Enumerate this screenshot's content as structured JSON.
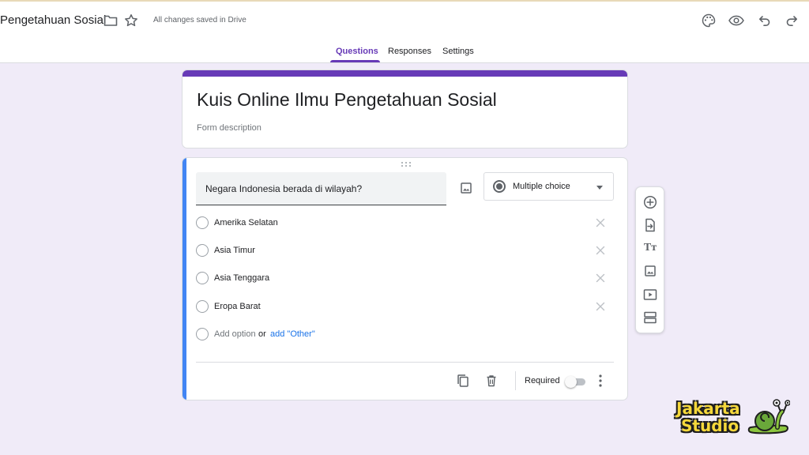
{
  "header": {
    "doc_title": "Pengetahuan Sosial",
    "save_status": "All changes saved in Drive",
    "icons": [
      "folder-icon",
      "star-icon",
      "palette-icon",
      "preview-icon",
      "undo-icon",
      "redo-icon"
    ]
  },
  "tabs": [
    {
      "label": "Questions",
      "active": true
    },
    {
      "label": "Responses",
      "active": false
    },
    {
      "label": "Settings",
      "active": false
    }
  ],
  "form": {
    "title": "Kuis Online Ilmu Pengetahuan Sosial",
    "description_placeholder": "Form description"
  },
  "question": {
    "text": "Negara Indonesia berada di wilayah?",
    "type": "Multiple choice",
    "options": [
      "Amerika Selatan",
      "Asia Timur",
      "Asia Tenggara",
      "Eropa Barat"
    ],
    "add_option": "Add option",
    "or": "or",
    "add_other": "add \"Other\"",
    "required_label": "Required",
    "required": false
  },
  "side_toolbar": [
    "add-question-icon",
    "import-questions-icon",
    "add-title-icon",
    "add-image-icon",
    "add-video-icon",
    "add-section-icon"
  ],
  "watermark": {
    "line1": "Jakarta",
    "line2": "Studio"
  },
  "colors": {
    "theme": "#673ab7",
    "background": "#f0ebf8",
    "active_question": "#4285f4",
    "link": "#1a73e8"
  }
}
